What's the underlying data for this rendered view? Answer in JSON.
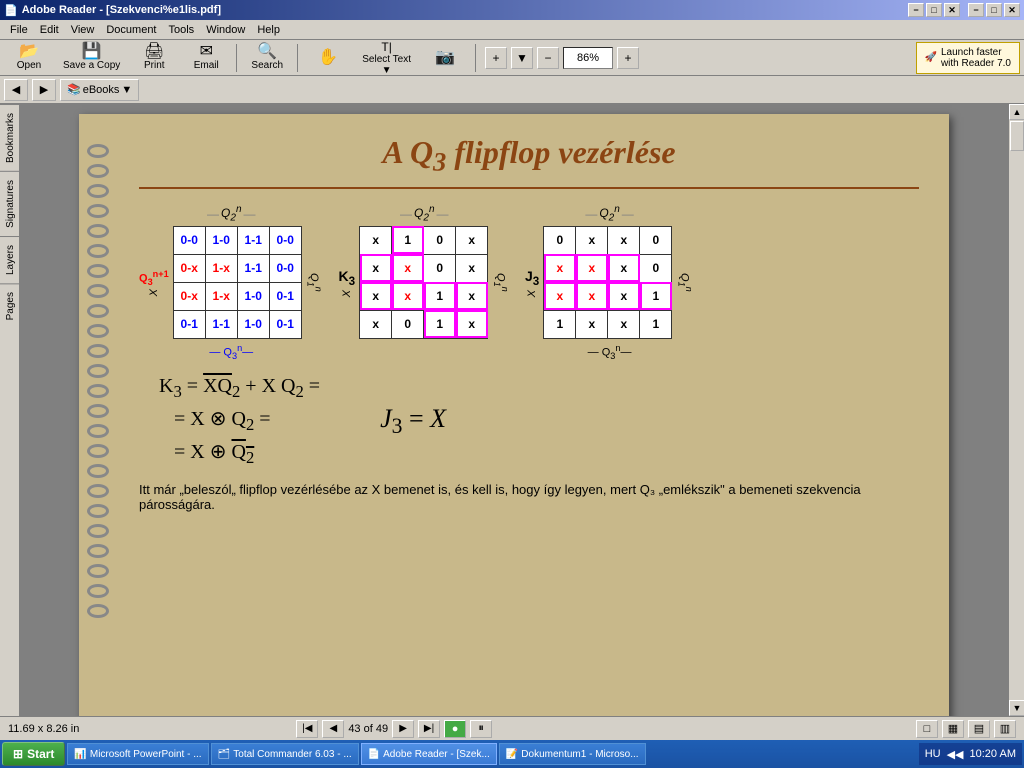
{
  "window": {
    "title": "Adobe Reader - [Szekvenci%e1lis.pdf]",
    "inner_title": "Szekvenci%e1lis.pdf"
  },
  "title_bar": {
    "title": "Adobe Reader - [Szekvenci%e1lis.pdf]",
    "min": "−",
    "max": "□",
    "close": "✕",
    "inner_min": "−",
    "inner_max": "□",
    "inner_close": "✕"
  },
  "menu": {
    "items": [
      "File",
      "Edit",
      "View",
      "Document",
      "Tools",
      "Window",
      "Help"
    ]
  },
  "toolbar": {
    "open": "Open",
    "save_copy": "Save a Copy",
    "print": "Print",
    "email": "Email",
    "search": "Search",
    "select_text": "Select Text",
    "zoom_value": "86%",
    "launch": "Launch faster\nwith Reader 7.0"
  },
  "sidebar": {
    "tabs": [
      "Bookmarks",
      "Signatures",
      "Layers",
      "Pages"
    ]
  },
  "page": {
    "title": "A Q₃ flipflop vezérlése",
    "number": "43 of 49"
  },
  "kmap1": {
    "label": "Q₃ⁿ⁺¹",
    "top_label": "— Q₂ⁿ—",
    "side_label": "Q₁ⁿ",
    "x_label": "X",
    "bottom_label": "— Q₃ⁿ—",
    "cells": [
      [
        "0-0",
        "1-0",
        "1-1",
        "0-0"
      ],
      [
        "0-x",
        "1-x",
        "1-1",
        "0-0"
      ],
      [
        "0-x",
        "1-x",
        "1-0",
        "0-1"
      ],
      [
        "0-1",
        "1-1",
        "1-0",
        "0-1"
      ]
    ]
  },
  "kmap2": {
    "label": "K₃",
    "top_label": "— Q₂ⁿ—",
    "side_label": "Q₁ⁿ",
    "cells": [
      [
        "x",
        "1",
        "0",
        "x"
      ],
      [
        "x",
        "x",
        "0",
        "x"
      ],
      [
        "x",
        "x",
        "1",
        "x"
      ],
      [
        "x",
        "0",
        "1",
        "x"
      ]
    ]
  },
  "kmap3": {
    "label": "J₃",
    "top_label": "— Q₂ⁿ—",
    "bottom_label": "— Q₃ⁿ—",
    "side_label": "Q₁ⁿ",
    "cells": [
      [
        "0",
        "x",
        "x",
        "0"
      ],
      [
        "x",
        "x",
        "x",
        "0"
      ],
      [
        "x",
        "x",
        "x",
        "1"
      ],
      [
        "1",
        "x",
        "x",
        "1"
      ]
    ]
  },
  "formula1": {
    "line1": "K₃ = X̄Q̄₂ + XQ₂ =",
    "line2": "= X ⊗ Q₂ =",
    "line3": "= X ⊕ Q̄₂"
  },
  "formula2": {
    "text": "J₃ = X"
  },
  "description": {
    "text": "Itt már „beleszól„ flipflop vezérlésébe az X bemenet is, és kell is, hogy így legyen, mert Q₃ „emlékszik\" a bemeneti szekvencia párosságára."
  },
  "status": {
    "dimensions": "11.69 x 8.26 in",
    "page": "43 of 49"
  },
  "taskbar": {
    "start": "Start",
    "items": [
      {
        "label": "Microsoft PowerPoint - ...",
        "icon": "📊",
        "active": false
      },
      {
        "label": "Total Commander 6.03 - ...",
        "icon": "🗂",
        "active": false
      },
      {
        "label": "Adobe Reader - [Szek...",
        "icon": "📄",
        "active": true
      },
      {
        "label": "Dokumentum1 - Microso...",
        "icon": "📝",
        "active": false
      }
    ],
    "time": "10:20 AM",
    "lang": "HU"
  }
}
